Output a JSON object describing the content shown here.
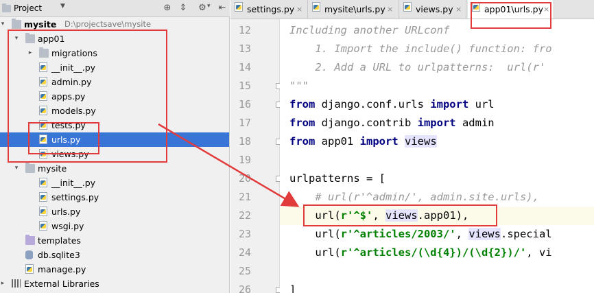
{
  "project_panel": {
    "title": "Project",
    "icons": [
      "target-icon",
      "collapse-icon",
      "gear-icon",
      "hide-icon"
    ]
  },
  "tree": [
    {
      "label": "mysite",
      "path": "D:\\projectsave\\mysite",
      "icon": "folder-icon",
      "expanded": true,
      "bold": true
    },
    {
      "label": "app01",
      "icon": "folder-icon",
      "expanded": true
    },
    {
      "label": "migrations",
      "icon": "folder-icon",
      "expanded": false
    },
    {
      "label": "__init__.py",
      "icon": "python-file-icon"
    },
    {
      "label": "admin.py",
      "icon": "python-file-icon"
    },
    {
      "label": "apps.py",
      "icon": "python-file-icon"
    },
    {
      "label": "models.py",
      "icon": "python-file-icon"
    },
    {
      "label": "tests.py",
      "icon": "python-file-icon"
    },
    {
      "label": "urls.py",
      "icon": "python-file-icon",
      "selected": true
    },
    {
      "label": "views.py",
      "icon": "python-file-icon"
    },
    {
      "label": "mysite",
      "icon": "folder-icon",
      "expanded": true
    },
    {
      "label": "__init__.py",
      "icon": "python-file-icon"
    },
    {
      "label": "settings.py",
      "icon": "python-file-icon"
    },
    {
      "label": "urls.py",
      "icon": "python-file-icon"
    },
    {
      "label": "wsgi.py",
      "icon": "python-file-icon"
    },
    {
      "label": "templates",
      "icon": "folder-icon"
    },
    {
      "label": "db.sqlite3",
      "icon": "database-icon"
    },
    {
      "label": "manage.py",
      "icon": "python-file-icon"
    },
    {
      "label": "External Libraries",
      "icon": "library-icon",
      "expanded": false
    }
  ],
  "tabs": [
    {
      "label": "settings.py",
      "close": "×"
    },
    {
      "label": "mysite\\urls.py",
      "close": "×"
    },
    {
      "label": "views.py",
      "close": "×"
    },
    {
      "label": "app01\\urls.py",
      "close": "×",
      "active": true
    }
  ],
  "editor": {
    "lines": [
      {
        "n": "12",
        "text": "Including another URLconf"
      },
      {
        "n": "13",
        "text": "    1. Import the include() function: fro"
      },
      {
        "n": "14",
        "text": "    2. Add a URL to urlpatterns:  url(r'"
      },
      {
        "n": "15",
        "text": "\"\"\""
      },
      {
        "n": "16",
        "text": "from django.conf.urls import url"
      },
      {
        "n": "17",
        "text": "from django.contrib import admin"
      },
      {
        "n": "18",
        "text": "from app01 import views"
      },
      {
        "n": "19",
        "text": ""
      },
      {
        "n": "20",
        "text": "urlpatterns = ["
      },
      {
        "n": "21",
        "text": "    # url(r'^admin/', admin.site.urls),"
      },
      {
        "n": "22",
        "text": "    url(r'^$', views.app01),"
      },
      {
        "n": "23",
        "text": "    url(r'^articles/2003/', views.special"
      },
      {
        "n": "24",
        "text": "    url(r'^articles/(\\d{4})/(\\d{2})/', vi"
      },
      {
        "n": "25",
        "text": ""
      },
      {
        "n": "26",
        "text": "]"
      }
    ]
  },
  "colors": {
    "annotation": "#e23b3b",
    "selection": "#3875d6",
    "keyword": "#000080",
    "string": "#008000"
  }
}
